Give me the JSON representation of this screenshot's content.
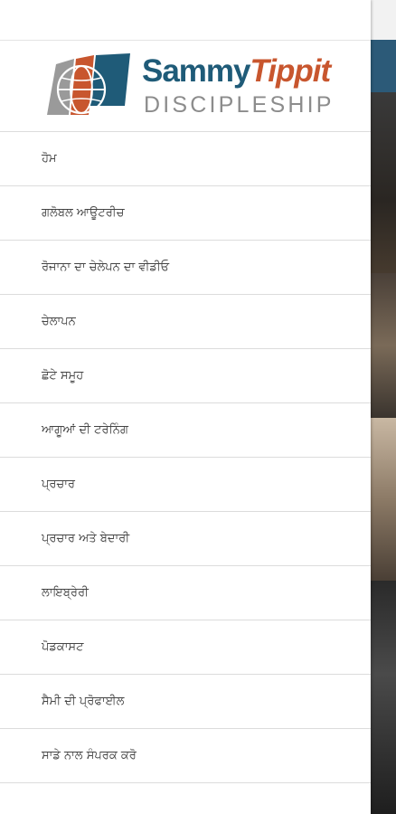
{
  "logo": {
    "name_part1": "Sammy",
    "name_part2": "Tippit",
    "subtitle": "DISCIPLESHIP",
    "colors": {
      "primary": "#1f5b78",
      "accent": "#c8562e",
      "gray": "#8c8c8c"
    }
  },
  "menu": {
    "items": [
      {
        "label": "ਹੋਮ"
      },
      {
        "label": "ਗਲੋਬਲ ਆਊਟਰੀਚ"
      },
      {
        "label": "ਰੋਜਾਨਾ ਦਾ ਚੇਲੇਪਨ ਦਾ ਵੀਡੀਓ"
      },
      {
        "label": "ਚੇਲਾਪਨ"
      },
      {
        "label": "ਛੋਟੇ ਸਮੂਹ"
      },
      {
        "label": "ਆਗੂਆਂ ਦੀ ਟਰੇਨਿੰਗ"
      },
      {
        "label": "ਪ੍ਰਚਾਰ"
      },
      {
        "label": "ਪ੍ਰਚਾਰ ਅਤੇ ਬੇਦਾਰੀ"
      },
      {
        "label": "ਲਾਇਬ੍ਰੇਰੀ"
      },
      {
        "label": "ਪੋਡਕਾਸਟ"
      },
      {
        "label": "ਸੈਮੀ ਦੀ ਪ੍ਰੋਫਾਈਲ"
      },
      {
        "label": "ਸਾਡੇ ਨਾਲ ਸੰਪਰਕ ਕਰੋ"
      }
    ]
  }
}
